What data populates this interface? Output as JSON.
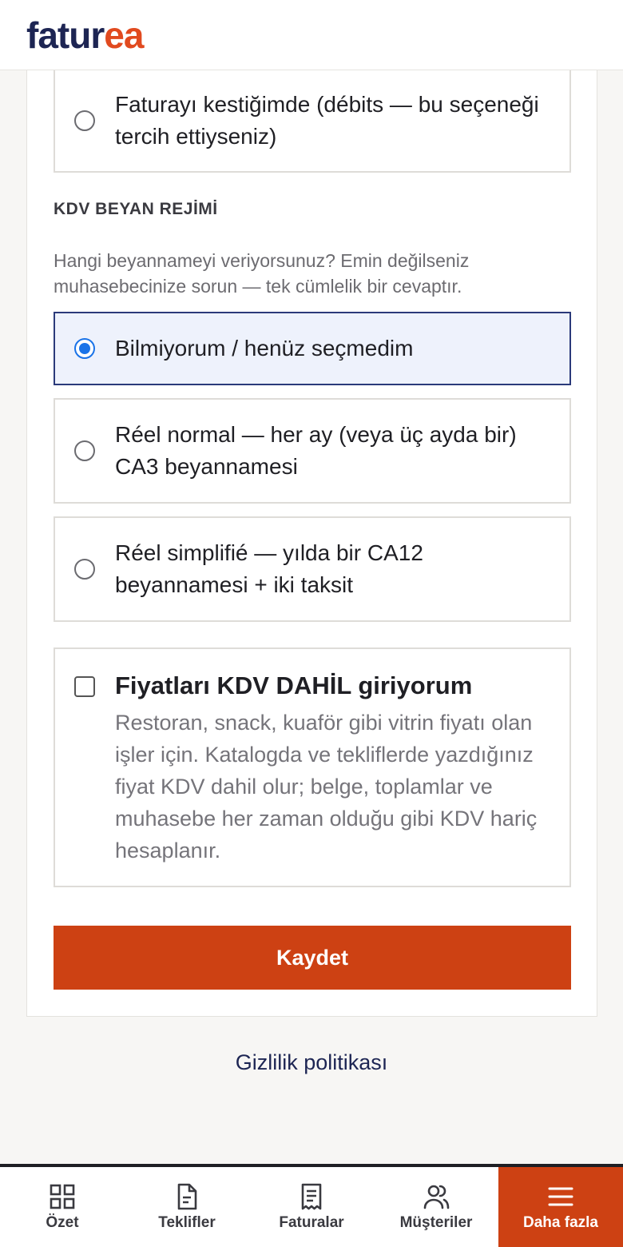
{
  "brand": {
    "part1": "fatur",
    "part2": "ea"
  },
  "top_option": {
    "label": "Faturayı kestiğimde (débits — bu seçeneği tercih ettiyseniz)"
  },
  "vat_section": {
    "title": "KDV BEYAN REJİMİ",
    "help": "Hangi beyannameyi veriyorsunuz? Emin değilseniz muhasebecinize sorun — tek cümlelik bir cevaptır.",
    "options": [
      {
        "label": "Bilmiyorum / henüz seçmedim",
        "selected": true
      },
      {
        "label": "Réel normal — her ay (veya üç ayda bir) CA3 beyannamesi",
        "selected": false
      },
      {
        "label": "Réel simplifié — yılda bir CA12 beyannamesi + iki taksit",
        "selected": false
      }
    ]
  },
  "prices_incl_vat": {
    "title": "Fiyatları KDV DAHİL giriyorum",
    "description": "Restoran, snack, kuaför gibi vitrin fiyatı olan işler için. Katalogda ve tekliflerde yazdığınız fiyat KDV dahil olur; belge, toplamlar ve muhasebe her zaman olduğu gibi KDV hariç hesaplanır.",
    "checked": false
  },
  "save_label": "Kaydet",
  "privacy_link": "Gizlilik politikası",
  "nav": [
    {
      "label": "Özet",
      "icon": "grid-icon",
      "active": false
    },
    {
      "label": "Teklifler",
      "icon": "document-icon",
      "active": false
    },
    {
      "label": "Faturalar",
      "icon": "receipt-icon",
      "active": false
    },
    {
      "label": "Müşteriler",
      "icon": "users-icon",
      "active": false
    },
    {
      "label": "Daha fazla",
      "icon": "menu-icon",
      "active": true
    }
  ],
  "colors": {
    "accent": "#cd4113",
    "brand_dark": "#1d2553",
    "brand_orange": "#e14a1f",
    "radio_blue": "#1a73e8"
  }
}
